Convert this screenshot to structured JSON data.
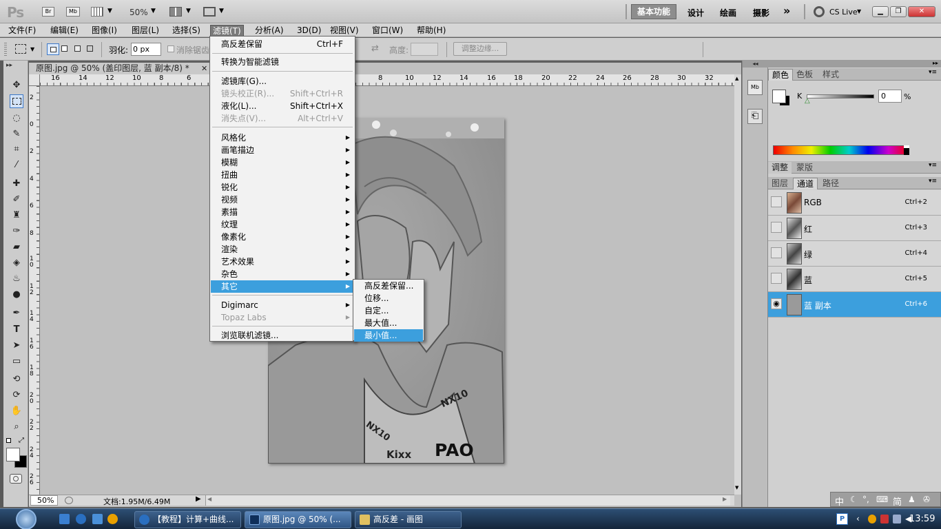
{
  "app": {
    "logo": "Ps",
    "zoom": "50%",
    "workspaces": [
      "基本功能",
      "设计",
      "绘画",
      "摄影"
    ],
    "overflow": "»",
    "cslive": "CS Live"
  },
  "menubar": [
    "文件(F)",
    "编辑(E)",
    "图像(I)",
    "图层(L)",
    "选择(S)",
    "滤镜(T)",
    "分析(A)",
    "3D(D)",
    "视图(V)",
    "窗口(W)",
    "帮助(H)"
  ],
  "options": {
    "feather_label": "羽化:",
    "feather_value": "0 px",
    "antialias_label": "消除锯齿",
    "height_label": "高度:",
    "refine_edge": "调整边缘..."
  },
  "document": {
    "tab_title": "原图.jpg @ 50% (盖印图层, 蓝 副本/8) *",
    "hruler_ticks": [
      "16",
      "14",
      "12",
      "10",
      "8",
      "6",
      "8",
      "10",
      "12",
      "14",
      "16",
      "18",
      "20",
      "22",
      "24",
      "26",
      "28",
      "30",
      "32"
    ],
    "vruler_ticks": [
      "2",
      "0",
      "2",
      "4",
      "6",
      "8",
      "1 0",
      "1 2",
      "1 4",
      "1 6",
      "1 8",
      "2 0",
      "2 2",
      "2 4",
      "2 6"
    ],
    "photo_text": [
      "NX10",
      "NX10",
      "Kixx",
      "PAO"
    ]
  },
  "status": {
    "zoom": "50%",
    "doc_info": "文档:1.95M/6.49M"
  },
  "filter_menu": {
    "items": [
      {
        "label": "高反差保留",
        "shortcut": "Ctrl+F"
      },
      {
        "label": "转换为智能滤镜"
      },
      {
        "label": "滤镜库(G)..."
      },
      {
        "label": "镜头校正(R)...",
        "shortcut": "Shift+Ctrl+R",
        "disabled": true
      },
      {
        "label": "液化(L)...",
        "shortcut": "Shift+Ctrl+X"
      },
      {
        "label": "消失点(V)...",
        "shortcut": "Alt+Ctrl+V",
        "disabled": true
      },
      {
        "label": "风格化"
      },
      {
        "label": "画笔描边"
      },
      {
        "label": "模糊"
      },
      {
        "label": "扭曲"
      },
      {
        "label": "锐化"
      },
      {
        "label": "视频"
      },
      {
        "label": "素描"
      },
      {
        "label": "纹理"
      },
      {
        "label": "像素化"
      },
      {
        "label": "渲染"
      },
      {
        "label": "艺术效果"
      },
      {
        "label": "杂色"
      },
      {
        "label": "其它",
        "highlighted": true
      },
      {
        "label": "Digimarc"
      },
      {
        "label": "Topaz Labs",
        "disabled": true
      },
      {
        "label": "浏览联机滤镜..."
      }
    ]
  },
  "other_submenu": {
    "items": [
      {
        "label": "高反差保留..."
      },
      {
        "label": "位移..."
      },
      {
        "label": "自定..."
      },
      {
        "label": "最大值..."
      },
      {
        "label": "最小值...",
        "highlighted": true
      }
    ]
  },
  "panels": {
    "color_tabs": [
      "颜色",
      "色板",
      "样式"
    ],
    "k_label": "K",
    "k_value": "0",
    "k_unit": "%",
    "adjust_tabs": [
      "调整",
      "蒙版"
    ],
    "layer_tabs": [
      "图层",
      "通道",
      "路径"
    ],
    "channels": [
      {
        "name": "RGB",
        "shortcut": "Ctrl+2"
      },
      {
        "name": "红",
        "shortcut": "Ctrl+3"
      },
      {
        "name": "绿",
        "shortcut": "Ctrl+4"
      },
      {
        "name": "蓝",
        "shortcut": "Ctrl+5"
      },
      {
        "name": "蓝 副本",
        "shortcut": "Ctrl+6",
        "selected": true
      }
    ]
  },
  "taskbar": {
    "buttons": [
      {
        "label": "【教程】计算+曲线...",
        "active": false
      },
      {
        "label": "原图.jpg @ 50% (...",
        "active": true
      },
      {
        "label": "高反差 - 画图",
        "active": false
      }
    ],
    "tray_ime": "中",
    "tray_ime2": "简",
    "clock": "13:59"
  },
  "colors": {
    "accent": "#3c9fdd",
    "menu_bg": "#f2f2f2",
    "panel_bg": "#d0d0d0",
    "canvas_bg": "#c0c0c0"
  }
}
